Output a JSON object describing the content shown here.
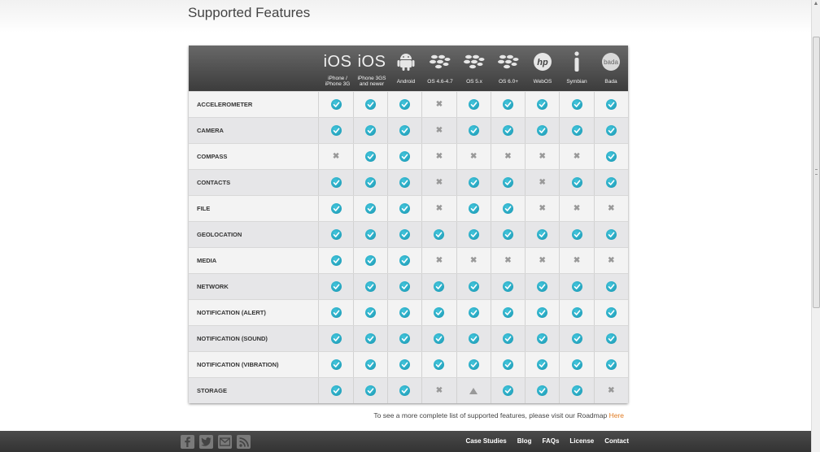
{
  "page": {
    "title": "Supported Features"
  },
  "columns": [
    {
      "icon": "ios-icon",
      "icon_text": "iOS",
      "label_lines": [
        "iPhone /",
        "iPhone 3G"
      ]
    },
    {
      "icon": "ios-icon",
      "icon_text": "iOS",
      "label_lines": [
        "iPhone 3GS",
        "and newer"
      ]
    },
    {
      "icon": "android-icon",
      "icon_text": "",
      "label_lines": [
        "Android"
      ]
    },
    {
      "icon": "blackberry-icon",
      "icon_text": "",
      "label_lines": [
        "OS 4.6-4.7"
      ]
    },
    {
      "icon": "blackberry-icon",
      "icon_text": "",
      "label_lines": [
        "OS 5.x"
      ]
    },
    {
      "icon": "blackberry-icon",
      "icon_text": "",
      "label_lines": [
        "OS 6.0+"
      ]
    },
    {
      "icon": "hp-icon",
      "icon_text": "hp",
      "label_lines": [
        "WebOS"
      ]
    },
    {
      "icon": "symbian-icon",
      "icon_text": "",
      "label_lines": [
        "Symbian"
      ]
    },
    {
      "icon": "bada-icon",
      "icon_text": "bada",
      "label_lines": [
        "Bada"
      ]
    }
  ],
  "rows": [
    {
      "feature": "ACCELEROMETER",
      "support": [
        "yes",
        "yes",
        "yes",
        "no",
        "yes",
        "yes",
        "yes",
        "yes",
        "yes"
      ]
    },
    {
      "feature": "CAMERA",
      "support": [
        "yes",
        "yes",
        "yes",
        "no",
        "yes",
        "yes",
        "yes",
        "yes",
        "yes"
      ]
    },
    {
      "feature": "COMPASS",
      "support": [
        "no",
        "yes",
        "yes",
        "no",
        "no",
        "no",
        "no",
        "no",
        "yes"
      ]
    },
    {
      "feature": "CONTACTS",
      "support": [
        "yes",
        "yes",
        "yes",
        "no",
        "yes",
        "yes",
        "no",
        "yes",
        "yes"
      ]
    },
    {
      "feature": "FILE",
      "support": [
        "yes",
        "yes",
        "yes",
        "no",
        "yes",
        "yes",
        "no",
        "no",
        "no"
      ]
    },
    {
      "feature": "GEOLOCATION",
      "support": [
        "yes",
        "yes",
        "yes",
        "yes",
        "yes",
        "yes",
        "yes",
        "yes",
        "yes"
      ]
    },
    {
      "feature": "MEDIA",
      "support": [
        "yes",
        "yes",
        "yes",
        "no",
        "no",
        "no",
        "no",
        "no",
        "no"
      ]
    },
    {
      "feature": "NETWORK",
      "support": [
        "yes",
        "yes",
        "yes",
        "yes",
        "yes",
        "yes",
        "yes",
        "yes",
        "yes"
      ]
    },
    {
      "feature": "NOTIFICATION (ALERT)",
      "support": [
        "yes",
        "yes",
        "yes",
        "yes",
        "yes",
        "yes",
        "yes",
        "yes",
        "yes"
      ]
    },
    {
      "feature": "NOTIFICATION (SOUND)",
      "support": [
        "yes",
        "yes",
        "yes",
        "yes",
        "yes",
        "yes",
        "yes",
        "yes",
        "yes"
      ]
    },
    {
      "feature": "NOTIFICATION (VIBRATION)",
      "support": [
        "yes",
        "yes",
        "yes",
        "yes",
        "yes",
        "yes",
        "yes",
        "yes",
        "yes"
      ]
    },
    {
      "feature": "STORAGE",
      "support": [
        "yes",
        "yes",
        "yes",
        "no",
        "partial",
        "yes",
        "yes",
        "yes",
        "no"
      ]
    }
  ],
  "legend_icons": {
    "yes": "check-circle-icon",
    "no": "cross-icon",
    "partial": "warning-triangle-icon"
  },
  "roadmap": {
    "text": "To see a more complete list of supported features, please visit our Roadmap",
    "link_label": "Here"
  },
  "footer": {
    "social": [
      {
        "icon": "facebook-icon"
      },
      {
        "icon": "twitter-icon"
      },
      {
        "icon": "email-icon"
      },
      {
        "icon": "rss-icon"
      }
    ],
    "nav": [
      "Case Studies",
      "Blog",
      "FAQs",
      "License",
      "Contact"
    ]
  },
  "colors": {
    "check": "#1fa3bf",
    "link": "#e07b22",
    "footer": "#3d3d3d",
    "header": "#4a4a4a"
  }
}
